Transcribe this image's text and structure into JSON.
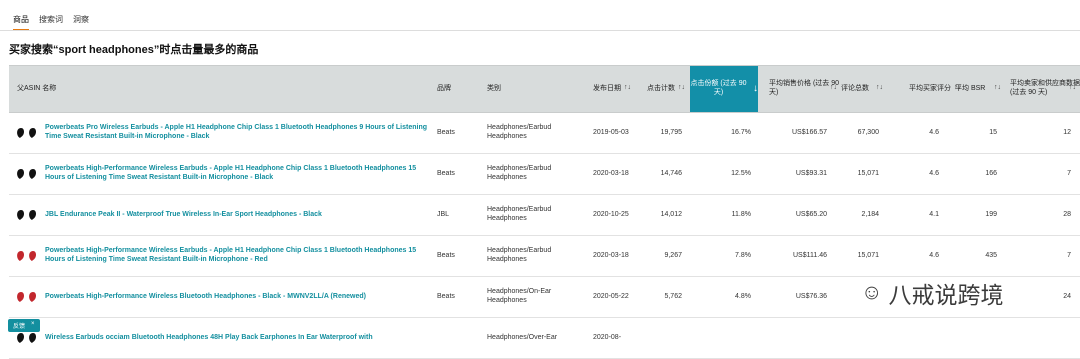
{
  "tabs": [
    "商品",
    "搜索词",
    "洞察"
  ],
  "title": "买家搜索“sport headphones”时点击量最多的商品",
  "headers": {
    "name": "ASIN 名称",
    "brand": "品牌",
    "category": "类别",
    "release_date": "发布日期",
    "clicks": "点击计数",
    "click_share": "点击份额 (过去 90 天)",
    "avg_price": "平均销售价格 (过去 90 天)",
    "reviews": "评论总数",
    "rating": "平均买家评分",
    "bsr": "平均 BSR",
    "sellers": "平均卖家和供应商数据 (过去 90 天)"
  },
  "rows": [
    {
      "name": "Powerbeats Pro Wireless Earbuds - Apple H1 Headphone Chip Class 1 Bluetooth Headphones 9 Hours of Listening Time Sweat Resistant Built-in Microphone - Black",
      "brand": "Beats",
      "category": "Headphones/Earbud Headphones",
      "date": "2019-05-03",
      "clicks": "19,795",
      "share": "16.7%",
      "price": "US$166.57",
      "reviews": "67,300",
      "rating": "4.6",
      "bsr": "15",
      "sellers": "12"
    },
    {
      "name": "Powerbeats High-Performance Wireless Earbuds - Apple H1 Headphone Chip Class 1 Bluetooth Headphones 15 Hours of Listening Time Sweat Resistant Built-in Microphone - Black",
      "brand": "Beats",
      "category": "Headphones/Earbud Headphones",
      "date": "2020-03-18",
      "clicks": "14,746",
      "share": "12.5%",
      "price": "US$93.31",
      "reviews": "15,071",
      "rating": "4.6",
      "bsr": "166",
      "sellers": "7"
    },
    {
      "name": "JBL Endurance Peak II - Waterproof True Wireless In-Ear Sport Headphones - Black",
      "brand": "JBL",
      "category": "Headphones/Earbud Headphones",
      "date": "2020-10-25",
      "clicks": "14,012",
      "share": "11.8%",
      "price": "US$65.20",
      "reviews": "2,184",
      "rating": "4.1",
      "bsr": "199",
      "sellers": "28"
    },
    {
      "name": "Powerbeats High-Performance Wireless Earbuds - Apple H1 Headphone Chip Class 1 Bluetooth Headphones 15 Hours of Listening Time Sweat Resistant Built-in Microphone - Red",
      "brand": "Beats",
      "category": "Headphones/Earbud Headphones",
      "date": "2020-03-18",
      "clicks": "9,267",
      "share": "7.8%",
      "price": "US$111.46",
      "reviews": "15,071",
      "rating": "4.6",
      "bsr": "435",
      "sellers": "7"
    },
    {
      "name": "Powerbeats High-Performance Wireless Bluetooth Headphones - Black - MWNV2LL/A (Renewed)",
      "brand": "Beats",
      "category": "Headphones/On-Ear Headphones",
      "date": "2020-05-22",
      "clicks": "5,762",
      "share": "4.8%",
      "price": "US$76.36",
      "reviews": "",
      "rating": "",
      "bsr": "",
      "sellers": "24"
    },
    {
      "name": "Wireless Earbuds occiam Bluetooth Headphones 48H Play Back Earphones In Ear Waterproof with",
      "brand": "",
      "category": "Headphones/Over-Ear",
      "date": "2020-08-",
      "clicks": "",
      "share": "",
      "price": "",
      "reviews": "",
      "rating": "",
      "bsr": "",
      "sellers": ""
    }
  ],
  "feedback_label": "反馈",
  "feedback_close": "×",
  "watermark": "八戒说跨境",
  "colors": {
    "accent": "#138fa8",
    "link": "#138f9f",
    "tab": "#e47911"
  }
}
